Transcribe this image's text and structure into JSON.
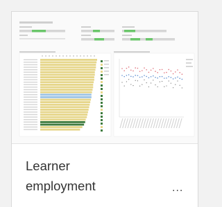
{
  "card": {
    "title_line_1": "Learner",
    "title_line_2": "employment",
    "more_label": "..."
  },
  "thumbnail": {
    "colors": {
      "filter_green": "#6ac66a",
      "filter_grey": "#bdbdbd",
      "bar_yellow": "#e6d68a",
      "bar_blue": "#9cc3e4",
      "bar_dark_green": "#3e7b3e",
      "line_red": "#e0707a",
      "line_blue": "#5d8fd0",
      "line_dark": "#6b6b6b"
    }
  }
}
